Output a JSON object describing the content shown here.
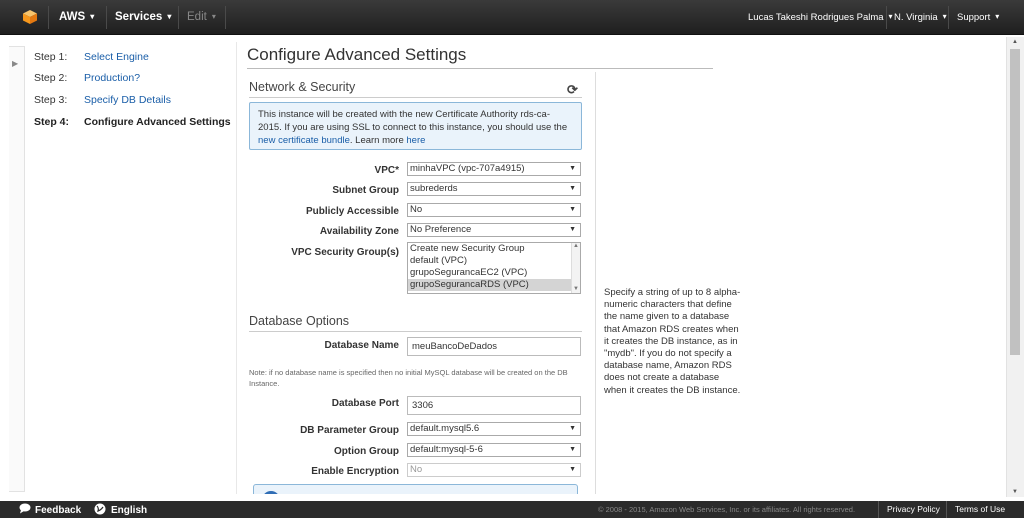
{
  "topnav": {
    "brand": "AWS",
    "services": "Services",
    "edit": "Edit",
    "user": "Lucas Takeshi Rodrigues Palma",
    "region": "N. Virginia",
    "support": "Support",
    "caret": "▾"
  },
  "steps": [
    {
      "num": "Step 1:",
      "label": "Select Engine"
    },
    {
      "num": "Step 2:",
      "label": "Production?"
    },
    {
      "num": "Step 3:",
      "label": "Specify DB Details"
    },
    {
      "num": "Step 4:",
      "label": "Configure Advanced Settings"
    }
  ],
  "page": {
    "title": "Configure Advanced Settings"
  },
  "network": {
    "title": "Network & Security",
    "info_text": "This instance will be created with the new Certificate Authority rds-ca-2015. If you are using SSL to connect to this instance, you should use the ",
    "info_link1": "new certificate bundle",
    "info_mid": ". Learn more ",
    "info_link2": "here",
    "vpc_label": "VPC*",
    "vpc_value": "minhaVPC (vpc-707a4915)",
    "subnet_label": "Subnet Group",
    "subnet_value": "subrederds",
    "public_label": "Publicly Accessible",
    "public_value": "No",
    "az_label": "Availability Zone",
    "az_value": "No Preference",
    "sg_label": "VPC Security Group(s)",
    "sg_options": [
      "Create new Security Group",
      "default (VPC)",
      "grupoSegurancaEC2 (VPC)",
      "grupoSegurancaRDS (VPC)"
    ]
  },
  "database": {
    "title": "Database Options",
    "name_label": "Database Name",
    "name_value": "meuBancoDeDados",
    "note": "Note: if no database name is specified then no initial MySQL database will be created on the DB Instance.",
    "port_label": "Database Port",
    "port_value": "3306",
    "param_label": "DB Parameter Group",
    "param_value": "default.mysql5.6",
    "option_label": "Option Group",
    "option_value": "default:mysql-5-6",
    "enc_label": "Enable Encryption",
    "enc_value": "No"
  },
  "help": {
    "text": "Specify a string of up to 8 alpha-numeric characters that define the name given to a database that Amazon RDS creates when it creates the DB instance, as in \"mydb\". If you do not specify a database name, Amazon RDS does not create a database when it creates the DB instance."
  },
  "footer": {
    "feedback": "Feedback",
    "language": "English",
    "copyright": "© 2008 - 2015, Amazon Web Services, Inc. or its affiliates. All rights reserved.",
    "privacy": "Privacy Policy",
    "terms": "Terms of Use"
  },
  "colors": {
    "link": "#1a5ea8",
    "nav_bg": "#2b2b2b",
    "info_bg": "#eaf3fb",
    "aws_orange": "#f7981d"
  }
}
